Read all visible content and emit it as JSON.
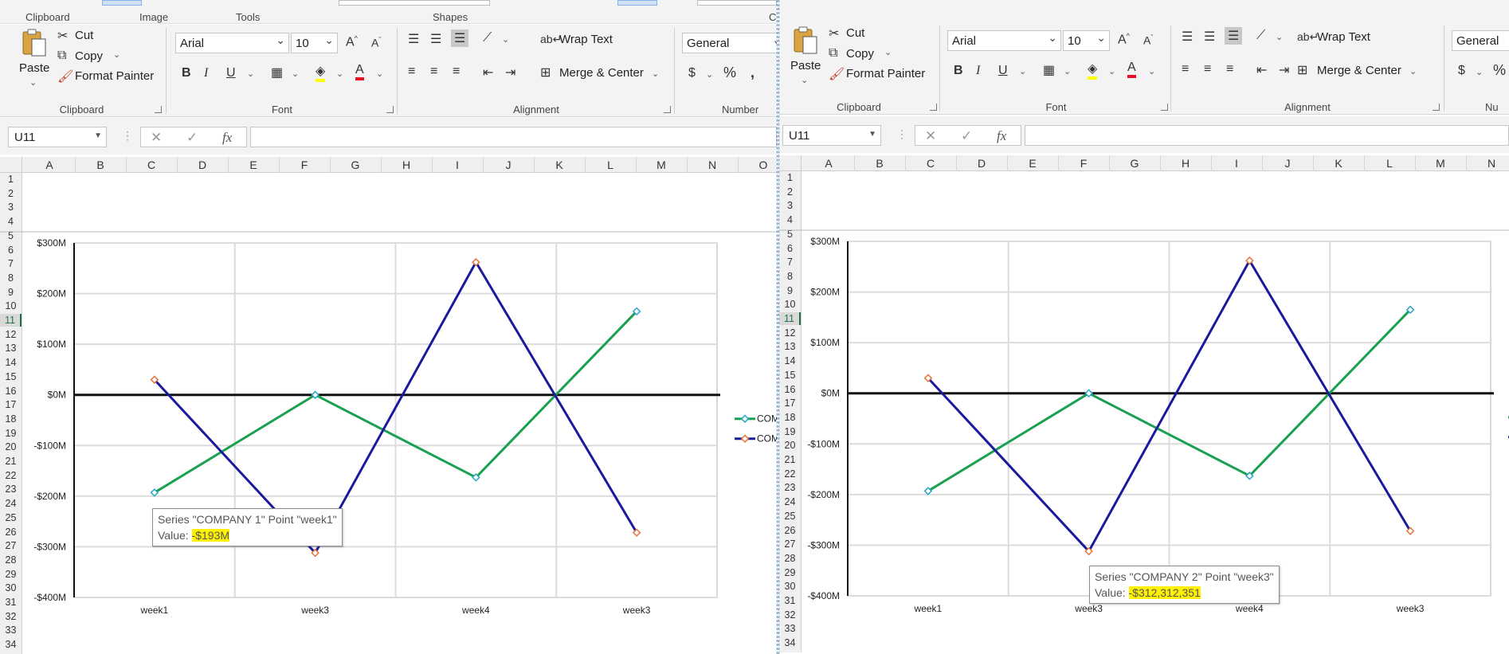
{
  "top_strip": {
    "groups": [
      "Clipboard",
      "Image",
      "Tools",
      "Shapes",
      "Colors"
    ]
  },
  "ribbon": {
    "clipboard": {
      "paste": "Paste",
      "cut": "Cut",
      "copy": "Copy",
      "format_painter": "Format Painter",
      "label": "Clipboard"
    },
    "font": {
      "name": "Arial",
      "size": "10",
      "label": "Font"
    },
    "alignment": {
      "wrap_text": "Wrap Text",
      "merge_center": "Merge & Center",
      "label": "Alignment"
    },
    "number": {
      "format": "General",
      "label": "Number",
      "label_clipped": "Nu"
    },
    "colors": {
      "highlight": "#ffff00",
      "font_color": "#e81123"
    }
  },
  "formula_bar": {
    "name_box": "U11",
    "fx": "fx",
    "content": ""
  },
  "sheet": {
    "columns_left": [
      "A",
      "B",
      "C",
      "D",
      "E",
      "F",
      "G",
      "H",
      "I",
      "J",
      "K",
      "L",
      "M",
      "N",
      "O"
    ],
    "columns_right": [
      "A",
      "B",
      "C",
      "D",
      "E",
      "F",
      "G",
      "H",
      "I",
      "J",
      "K",
      "L",
      "M",
      "N"
    ],
    "rows": [
      "1",
      "2",
      "3",
      "4",
      "5",
      "6",
      "7",
      "8",
      "9",
      "10",
      "11",
      "12",
      "13",
      "14",
      "15",
      "16",
      "17",
      "18",
      "19",
      "20",
      "21",
      "22",
      "23",
      "24",
      "25",
      "26",
      "27",
      "28",
      "29",
      "30",
      "31",
      "32",
      "33",
      "34"
    ],
    "selected_row": "11"
  },
  "chart_data": [
    {
      "type": "line",
      "categories": [
        "week1",
        "week3",
        "week4",
        "week3"
      ],
      "ylim": [
        -400,
        300
      ],
      "y_ticks": [
        "$300M",
        "$200M",
        "$100M",
        "$0M",
        "-$100M",
        "-$200M",
        "-$300M",
        "-$400M"
      ],
      "grid": true,
      "legend": "right",
      "series": [
        {
          "name": "COMPANY 1",
          "values": [
            -193,
            0,
            -163,
            165
          ],
          "color": "#1aa150",
          "legend_label": "COM"
        },
        {
          "name": "COMPANY 2",
          "values": [
            30,
            -312,
            262,
            -272
          ],
          "color": "#1a1a9c",
          "legend_label": "COM"
        }
      ],
      "tooltip": {
        "line1": "Series \"COMPANY 1\" Point \"week1\"",
        "label": "Value: ",
        "value": "-$193M"
      }
    },
    {
      "type": "line",
      "categories": [
        "week1",
        "week3",
        "week4",
        "week3"
      ],
      "ylim": [
        -400,
        300
      ],
      "y_ticks": [
        "$300M",
        "$200M",
        "$100M",
        "$0M",
        "-$100M",
        "-$200M",
        "-$300M",
        "-$400M"
      ],
      "grid": true,
      "legend": "right",
      "series": [
        {
          "name": "COMPANY 1",
          "values": [
            -193,
            0,
            -163,
            165
          ],
          "color": "#1aa150"
        },
        {
          "name": "COMPANY 2",
          "values": [
            30,
            -312,
            262,
            -272
          ],
          "color": "#1a1a9c"
        }
      ],
      "tooltip": {
        "line1": "Series \"COMPANY 2\" Point \"week3\"",
        "label": "Value: ",
        "value": "-$312,312,351"
      }
    }
  ]
}
